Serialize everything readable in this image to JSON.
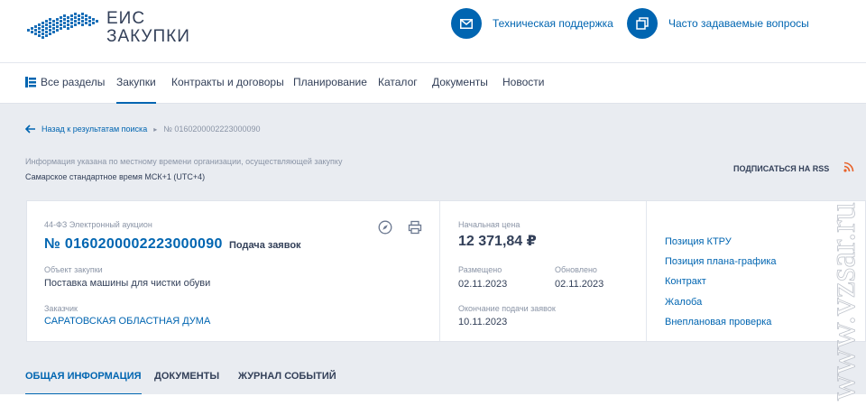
{
  "header": {
    "logo_line1": "ЕИС",
    "logo_line2": "ЗАКУПКИ",
    "support_label": "Техническая поддержка",
    "faq_label": "Часто задаваемые вопросы"
  },
  "nav": {
    "items": [
      {
        "label": "Все разделы"
      },
      {
        "label": "Закупки"
      },
      {
        "label": "Контракты и договоры"
      },
      {
        "label": "Планирование"
      },
      {
        "label": "Каталог"
      },
      {
        "label": "Документы"
      },
      {
        "label": "Новости"
      }
    ],
    "active": "Закупки"
  },
  "breadcrumb": {
    "back_label": "Назад к результатам поиска",
    "current": "№ 0160200002223000090"
  },
  "timezone": {
    "info": "Информация указана по местному времени организации, осуществляющей закупку",
    "value": "Самарское стандартное время МСК+1 (UTC+4)"
  },
  "rss_label": "ПОДПИСАТЬСЯ НА RSS",
  "purchase": {
    "law_type": "44-ФЗ Электронный аукцион",
    "number": "№ 0160200002223000090",
    "stage": "Подача заявок",
    "object_label": "Объект закупки",
    "object_value": "Поставка машины для чистки обуви",
    "customer_label": "Заказчик",
    "customer_value": "САРАТОВСКАЯ ОБЛАСТНАЯ ДУМА",
    "price_label": "Начальная цена",
    "price_value": "12 371,84 ₽",
    "posted_label": "Размещено",
    "posted_value": "02.11.2023",
    "updated_label": "Обновлено",
    "updated_value": "02.11.2023",
    "deadline_label": "Окончание подачи заявок",
    "deadline_value": "10.11.2023"
  },
  "side_links": [
    {
      "label": "Позиция КТРУ"
    },
    {
      "label": "Позиция плана-графика"
    },
    {
      "label": "Контракт"
    },
    {
      "label": "Жалоба"
    },
    {
      "label": "Внеплановая проверка"
    }
  ],
  "tabs": [
    {
      "label": "ОБЩАЯ ИНФОРМАЦИЯ"
    },
    {
      "label": "ДОКУМЕНТЫ"
    },
    {
      "label": "ЖУРНАЛ СОБЫТИЙ"
    }
  ],
  "watermark": "www.vzsar.ru",
  "colors": {
    "accent": "#0065b1",
    "text": "#334059",
    "muted": "#8a94a6",
    "rss": "#e8622a"
  }
}
